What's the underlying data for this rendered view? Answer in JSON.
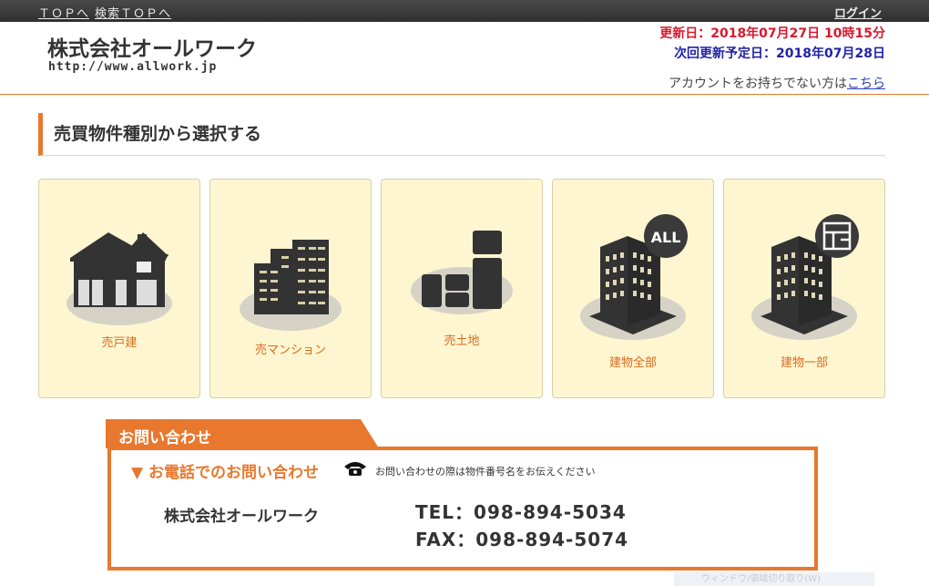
{
  "topbar": {
    "top_link": "ＴＯＰへ",
    "search_top_link": "検索ＴＯＰへ",
    "login_link": "ログイン"
  },
  "header": {
    "company": "株式会社オールワーク",
    "url": "http://www.allwork.jp",
    "updated": "更新日：2018年07月27日 10時15分",
    "next_update": "次回更新予定日：2018年07月28日",
    "account_text": "アカウントをお持ちでない方は",
    "account_link": "こちら"
  },
  "section": {
    "title": "売買物件種別から選択する"
  },
  "categories": [
    {
      "label": "売戸建",
      "icon": "house-icon"
    },
    {
      "label": "売マンション",
      "icon": "apartment-icon"
    },
    {
      "label": "売土地",
      "icon": "land-icon"
    },
    {
      "label": "建物全部",
      "icon": "building-all-icon",
      "badge": "ALL"
    },
    {
      "label": "建物一部",
      "icon": "building-part-icon"
    }
  ],
  "contact": {
    "tab": "お問い合わせ",
    "heading": "▼ お電話でのお問い合わせ",
    "note": "お問い合わせの際は物件番号名をお伝えください",
    "company": "株式会社オールワーク",
    "tel": "TEL：098-894-5034",
    "fax": "FAX：098-894-5074"
  },
  "colors": {
    "accent": "#e8782e",
    "card_bg": "#fdf6d0",
    "updated": "#d9182d",
    "next_update": "#2222aa"
  },
  "overlay": {
    "text": "ウィンドウ/領域切り取り(W)"
  }
}
